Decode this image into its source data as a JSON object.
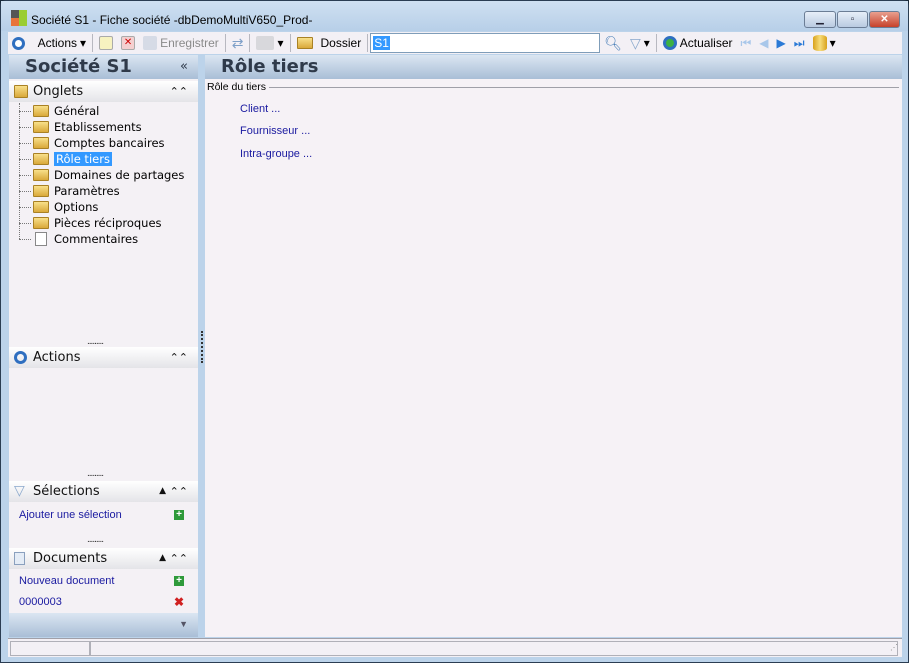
{
  "window": {
    "title": "Société S1 -  Fiche société -dbDemoMultiV650_Prod-"
  },
  "toolbar": {
    "actions": "Actions",
    "save": "Enregistrer",
    "folder": "Dossier",
    "search_value": "S1",
    "refresh": "Actualiser"
  },
  "left": {
    "title": "Société S1",
    "collapse": "«",
    "onglets": {
      "label": "Onglets",
      "items": [
        "Général",
        "Etablissements",
        "Comptes bancaires",
        "Rôle tiers",
        "Domaines de partages",
        "Paramètres",
        "Options",
        "Pièces réciproques",
        "Commentaires"
      ]
    },
    "actions": {
      "label": "Actions"
    },
    "selections": {
      "label": "Sélections",
      "add": "Ajouter une sélection"
    },
    "documents": {
      "label": "Documents",
      "new": "Nouveau document",
      "items": [
        "0000003"
      ]
    }
  },
  "main": {
    "title": "Rôle tiers",
    "group": "Rôle du tiers",
    "links": [
      "Client ...",
      "Fournisseur ...",
      "Intra-groupe ..."
    ]
  }
}
